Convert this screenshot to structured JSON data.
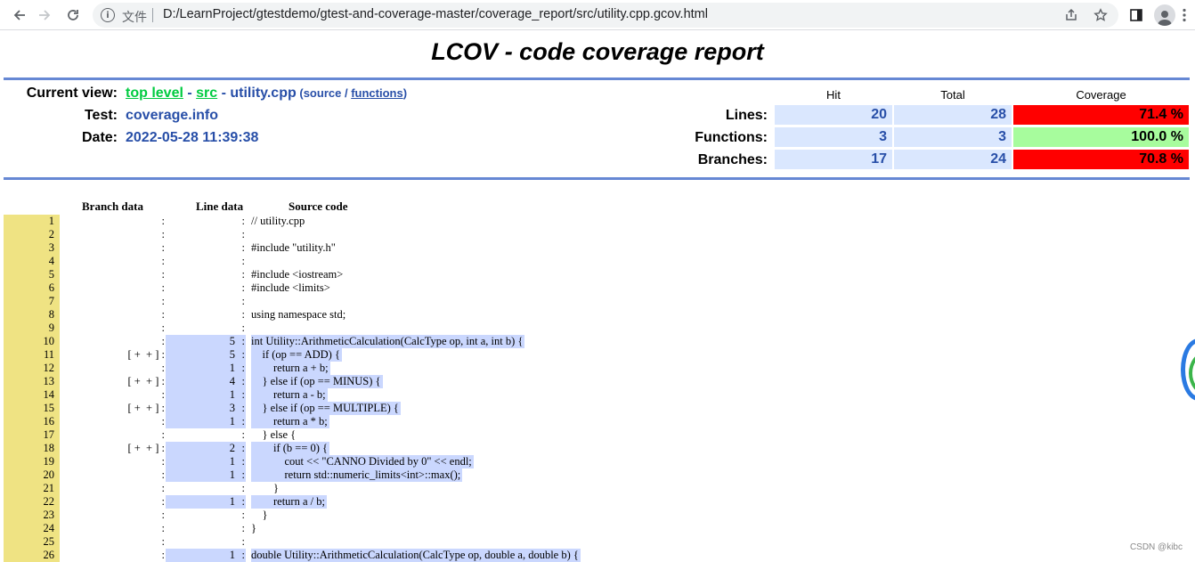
{
  "browser": {
    "file_label": "文件",
    "url": "D:/LearnProject/gtestdemo/gtest-and-coverage-master/coverage_report/src/utility.cpp.gcov.html"
  },
  "report": {
    "title": "LCOV - code coverage report",
    "current_view_label": "Current view:",
    "crumb_top": "top level",
    "crumb_sep1": " - ",
    "crumb_src": "src",
    "crumb_sep2": " - ",
    "crumb_file": "utility.cpp",
    "crumb_paren_open": " (",
    "source_label": "source",
    "slash": " / ",
    "functions_label": "functions",
    "crumb_paren_close": ")",
    "test_label": "Test:",
    "test_value": "coverage.info",
    "date_label": "Date:",
    "date_value": "2022-05-28 11:39:38",
    "headers": {
      "hit": "Hit",
      "total": "Total",
      "coverage": "Coverage"
    },
    "summary": [
      {
        "label": "Lines:",
        "hit": "20",
        "total": "28",
        "coverage": "71.4 %",
        "color": "#ff0000"
      },
      {
        "label": "Functions:",
        "hit": "3",
        "total": "3",
        "coverage": "100.0 %",
        "color": "#a7fc9d"
      },
      {
        "label": "Branches:",
        "hit": "17",
        "total": "24",
        "coverage": "70.8 %",
        "color": "#ff0000"
      }
    ]
  },
  "listing": {
    "headers": {
      "branch": "Branch data",
      "line": "Line data",
      "source": "Source code"
    },
    "rows": [
      {
        "n": "1",
        "branch": "",
        "count": "",
        "code": "// utility.cpp"
      },
      {
        "n": "2",
        "branch": "",
        "count": "",
        "code": ""
      },
      {
        "n": "3",
        "branch": "",
        "count": "",
        "code": "#include \"utility.h\""
      },
      {
        "n": "4",
        "branch": "",
        "count": "",
        "code": ""
      },
      {
        "n": "5",
        "branch": "",
        "count": "",
        "code": "#include <iostream>"
      },
      {
        "n": "6",
        "branch": "",
        "count": "",
        "code": "#include <limits>"
      },
      {
        "n": "7",
        "branch": "",
        "count": "",
        "code": ""
      },
      {
        "n": "8",
        "branch": "",
        "count": "",
        "code": "using namespace std;"
      },
      {
        "n": "9",
        "branch": "",
        "count": "",
        "code": ""
      },
      {
        "n": "10",
        "branch": "",
        "count": "5",
        "code": "int Utility::ArithmeticCalculation(CalcType op, int a, int b) {"
      },
      {
        "n": "11",
        "branch": "[ +  + ]",
        "count": "5",
        "code": "    if (op == ADD) {"
      },
      {
        "n": "12",
        "branch": "",
        "count": "1",
        "code": "        return a + b;"
      },
      {
        "n": "13",
        "branch": "[ +  + ]",
        "count": "4",
        "code": "    } else if (op == MINUS) {"
      },
      {
        "n": "14",
        "branch": "",
        "count": "1",
        "code": "        return a - b;"
      },
      {
        "n": "15",
        "branch": "[ +  + ]",
        "count": "3",
        "code": "    } else if (op == MULTIPLE) {"
      },
      {
        "n": "16",
        "branch": "",
        "count": "1",
        "code": "        return a * b;"
      },
      {
        "n": "17",
        "branch": "",
        "count": "",
        "code": "    } else {"
      },
      {
        "n": "18",
        "branch": "[ +  + ]",
        "count": "2",
        "code": "        if (b == 0) {"
      },
      {
        "n": "19",
        "branch": "",
        "count": "1",
        "code": "            cout << \"CANNO Divided by 0\" << endl;"
      },
      {
        "n": "20",
        "branch": "",
        "count": "1",
        "code": "            return std::numeric_limits<int>::max();"
      },
      {
        "n": "21",
        "branch": "",
        "count": "",
        "code": "        }"
      },
      {
        "n": "22",
        "branch": "",
        "count": "1",
        "code": "        return a / b;"
      },
      {
        "n": "23",
        "branch": "",
        "count": "",
        "code": "    }"
      },
      {
        "n": "24",
        "branch": "",
        "count": "",
        "code": "}"
      },
      {
        "n": "25",
        "branch": "",
        "count": "",
        "code": ""
      },
      {
        "n": "26",
        "branch": "",
        "count": "1",
        "code": "double Utility::ArithmeticCalculation(CalcType op, double a, double b) {"
      }
    ]
  },
  "watermark": "CSDN @kibc"
}
